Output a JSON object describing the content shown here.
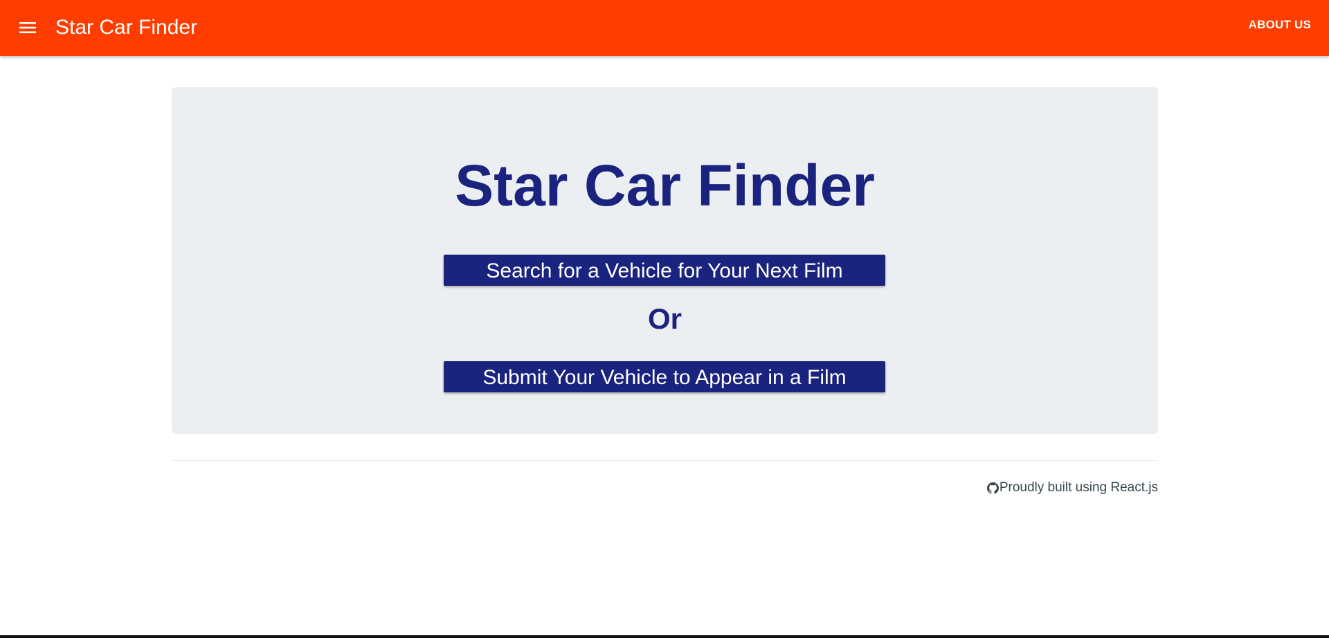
{
  "appbar": {
    "title": "Star Car Finder",
    "menu_icon": "hamburger-menu-icon",
    "about_label": "ABOUT US",
    "color": "#ff3d00"
  },
  "hero": {
    "title": "Star Car Finder",
    "search_button": "Search for a Vehicle for Your Next Film",
    "or_text": "Or",
    "submit_button": "Submit Your Vehicle to Appear in a Film",
    "accent": "#1a237e",
    "background": "#eceff1"
  },
  "footer": {
    "icon": "github-icon",
    "text": "Proudly built using React.js"
  }
}
